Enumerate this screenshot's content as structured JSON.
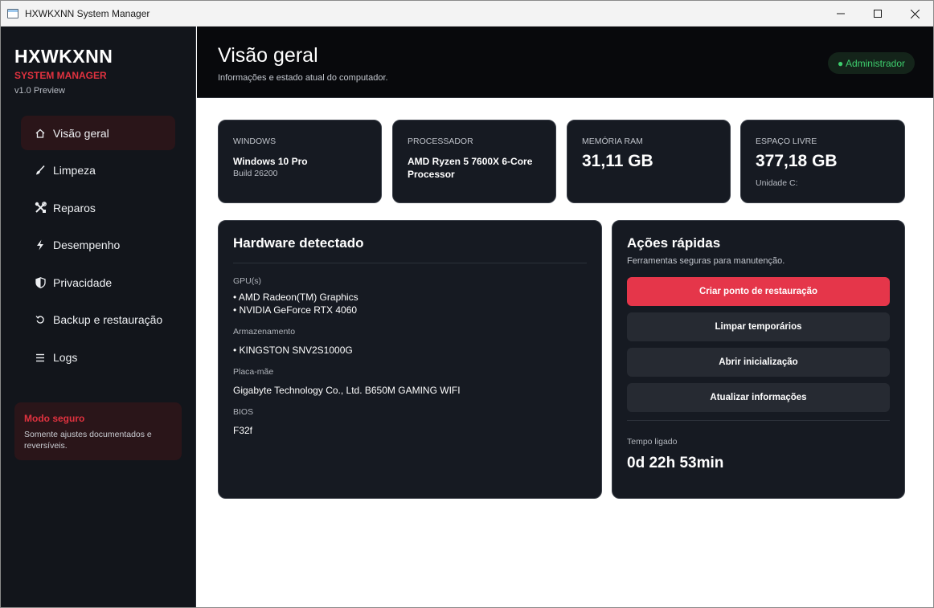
{
  "window": {
    "title": "HXWKXNN System Manager"
  },
  "sidebar": {
    "brand_name": "HXWKXNN",
    "brand_sub": "SYSTEM MANAGER",
    "version": "v1.0 Preview",
    "items": [
      {
        "label": "Visão geral",
        "icon": "home-icon",
        "active": true
      },
      {
        "label": "Limpeza",
        "icon": "brush-icon"
      },
      {
        "label": "Reparos",
        "icon": "tools-icon"
      },
      {
        "label": "Desempenho",
        "icon": "lightning-icon"
      },
      {
        "label": "Privacidade",
        "icon": "shield-icon"
      },
      {
        "label": "Backup e restauração",
        "icon": "restore-icon"
      },
      {
        "label": "Logs",
        "icon": "list-icon"
      }
    ],
    "safe_mode": {
      "title": "Modo seguro",
      "text": "Somente ajustes documentados e reversíveis."
    }
  },
  "header": {
    "title": "Visão geral",
    "subtitle": "Informações e estado atual do computador.",
    "badge": "● Administrador",
    "badge_color": "#3ecf6e"
  },
  "stats": {
    "windows": {
      "label": "WINDOWS",
      "value": "Windows 10 Pro",
      "sub": "Build 26200"
    },
    "cpu": {
      "label": "PROCESSADOR",
      "value": "AMD Ryzen 5 7600X 6-Core Processor"
    },
    "ram": {
      "label": "MEMÓRIA RAM",
      "value": "31,11 GB"
    },
    "disk": {
      "label": "ESPAÇO LIVRE",
      "value": "377,18 GB",
      "sub": "Unidade C:"
    }
  },
  "hardware": {
    "title": "Hardware detectado",
    "gpu_label": "GPU(s)",
    "gpus": [
      "• AMD Radeon(TM) Graphics",
      "• NVIDIA GeForce RTX 4060"
    ],
    "storage_label": "Armazenamento",
    "storage": [
      "• KINGSTON SNV2S1000G"
    ],
    "board_label": "Placa-mãe",
    "board": "Gigabyte Technology Co., Ltd. B650M GAMING WIFI",
    "bios_label": "BIOS",
    "bios": "F32f"
  },
  "quick_actions": {
    "title": "Ações rápidas",
    "subtitle": "Ferramentas seguras para manutenção.",
    "buttons": [
      "Criar ponto de restauração",
      "Limpar temporários",
      "Abrir inicialização",
      "Atualizar informações"
    ],
    "uptime_label": "Tempo ligado",
    "uptime_value": "0d 22h 53min"
  },
  "colors": {
    "accent": "#e5364a",
    "sidebar_bg": "#12151b",
    "card_bg": "#161a22"
  }
}
